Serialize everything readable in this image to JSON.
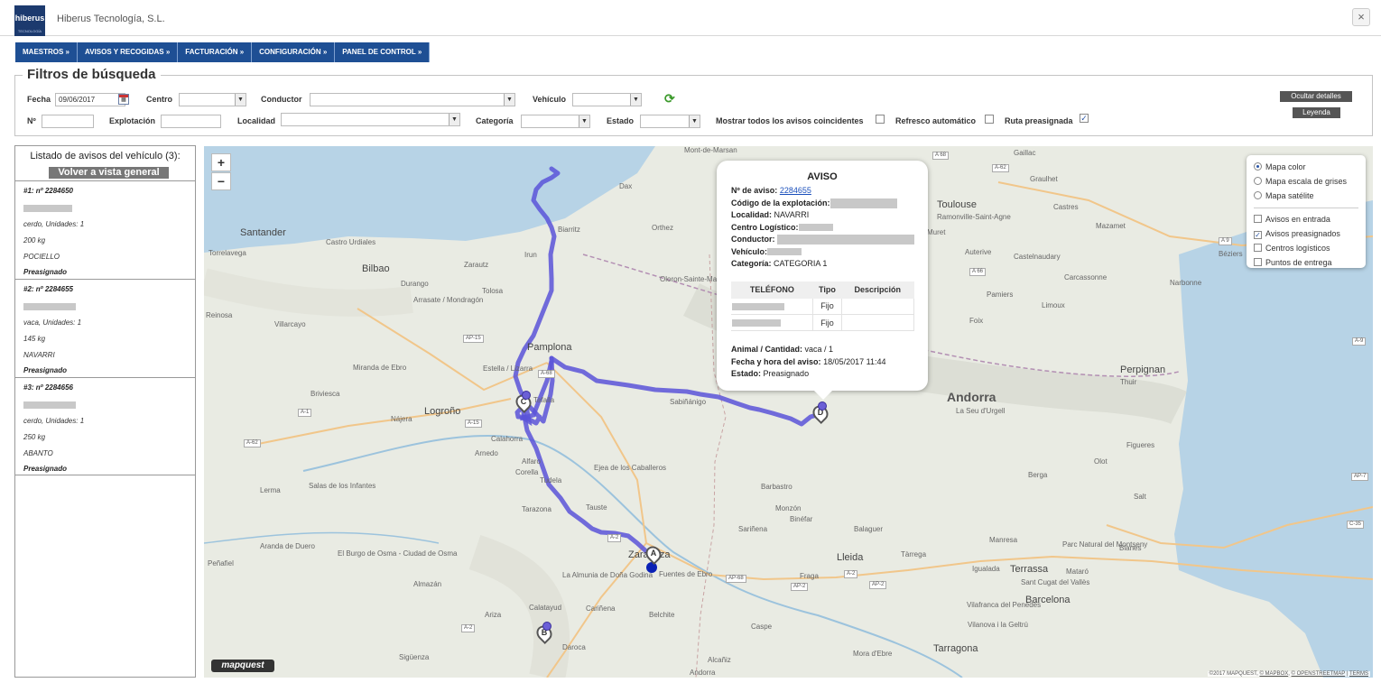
{
  "header": {
    "logo_text": "hiberus",
    "logo_subtext": "TECNOLOGÍA",
    "company": "Hiberus Tecnología, S.L.",
    "close_symbol": "×"
  },
  "menu": [
    {
      "label": "MAESTROS »"
    },
    {
      "label": "AVISOS Y RECOGIDAS »"
    },
    {
      "label": "FACTURACIÓN »"
    },
    {
      "label": "CONFIGURACIÓN »"
    },
    {
      "label": "PANEL DE CONTROL »"
    }
  ],
  "filters": {
    "legend": "Filtros de búsqueda",
    "fecha_label": "Fecha",
    "fecha_value": "09/06/2017",
    "centro_label": "Centro",
    "conductor_label": "Conductor",
    "vehiculo_label": "Vehículo",
    "numero_label": "Nº",
    "explotacion_label": "Explotación",
    "localidad_label": "Localidad",
    "categoria_label": "Categoría",
    "estado_label": "Estado",
    "mostrar_label": "Mostrar todos los avisos coincidentes",
    "refresco_label": "Refresco automático",
    "ruta_label": "Ruta preasignada",
    "ruta_checked": "✓",
    "ocultar_button": "Ocultar detalles",
    "leyenda_button": "Leyenda",
    "refresh_icon": "refresh-icon"
  },
  "list": {
    "title": "Listado de avisos del vehículo (3):",
    "back_button": "Volver a vista general",
    "items": [
      {
        "header": "#1: nº 2284650",
        "detail": "cerdo, Unidades: 1",
        "weight": "200 kg",
        "locality": "POCIELLO",
        "status": "Preasignado"
      },
      {
        "header": "#2: nº 2284655",
        "detail": "vaca, Unidades: 1",
        "weight": "145 kg",
        "locality": "NAVARRI",
        "status": "Preasignado"
      },
      {
        "header": "#3: nº 2284656",
        "detail": "cerdo, Unidades: 1",
        "weight": "250 kg",
        "locality": "ABANTO",
        "status": "Preasignado"
      }
    ]
  },
  "map": {
    "zoom_in": "+",
    "zoom_out": "−",
    "logo": "mapquest",
    "attribution_prefix": "©2017 MAPQUEST,",
    "attribution_mapbox": "© MAPBOX",
    "attribution_osm": "© OPENSTREETMAP",
    "attribution_terms": "TERMS",
    "route_color": "#5a54d8",
    "marker_a": "A",
    "marker_b": "B",
    "marker_c": "C",
    "marker_d": "D",
    "places": [
      {
        "name": "Santander",
        "cls": "big"
      },
      {
        "name": "Torrelavega",
        "cls": ""
      },
      {
        "name": "Castro Urdiales",
        "cls": ""
      },
      {
        "name": "Bilbao",
        "cls": "big"
      },
      {
        "name": "Zarautz",
        "cls": ""
      },
      {
        "name": "Irun",
        "cls": ""
      },
      {
        "name": "Biarritz",
        "cls": ""
      },
      {
        "name": "Dax",
        "cls": ""
      },
      {
        "name": "Orthez",
        "cls": ""
      },
      {
        "name": "Mont-de-Marsan",
        "cls": ""
      },
      {
        "name": "Durango",
        "cls": ""
      },
      {
        "name": "Tolosa",
        "cls": ""
      },
      {
        "name": "Arrasate / Mondragón",
        "cls": ""
      },
      {
        "name": "Oloron-Sainte-Marie",
        "cls": ""
      },
      {
        "name": "Villarcayo",
        "cls": ""
      },
      {
        "name": "Reinosa",
        "cls": ""
      },
      {
        "name": "Pamplona",
        "cls": "big"
      },
      {
        "name": "Estella / Lizarra",
        "cls": ""
      },
      {
        "name": "Miranda de Ebro",
        "cls": ""
      },
      {
        "name": "Briviesca",
        "cls": ""
      },
      {
        "name": "Logroño",
        "cls": "big"
      },
      {
        "name": "Nájera",
        "cls": ""
      },
      {
        "name": "Tafalla",
        "cls": ""
      },
      {
        "name": "Calahorra",
        "cls": ""
      },
      {
        "name": "Arnedo",
        "cls": ""
      },
      {
        "name": "Alfaro",
        "cls": ""
      },
      {
        "name": "Corella",
        "cls": ""
      },
      {
        "name": "Tudela",
        "cls": ""
      },
      {
        "name": "Ejea de los Caballeros",
        "cls": ""
      },
      {
        "name": "Lerma",
        "cls": ""
      },
      {
        "name": "Salas de los Infantes",
        "cls": ""
      },
      {
        "name": "Tarazona",
        "cls": ""
      },
      {
        "name": "Tauste",
        "cls": ""
      },
      {
        "name": "Zaragoza",
        "cls": "big"
      },
      {
        "name": "Fuentes de Ebro",
        "cls": ""
      },
      {
        "name": "La Almunia de Doña Godina",
        "cls": ""
      },
      {
        "name": "Aranda de Duero",
        "cls": ""
      },
      {
        "name": "El Burgo de Osma - Ciudad de Osma",
        "cls": ""
      },
      {
        "name": "Peñafiel",
        "cls": ""
      },
      {
        "name": "Almazán",
        "cls": ""
      },
      {
        "name": "Calatayud",
        "cls": ""
      },
      {
        "name": "Cariñena",
        "cls": ""
      },
      {
        "name": "Ariza",
        "cls": ""
      },
      {
        "name": "Belchite",
        "cls": ""
      },
      {
        "name": "Daroca",
        "cls": ""
      },
      {
        "name": "Sigüenza",
        "cls": ""
      },
      {
        "name": "Alcañiz",
        "cls": ""
      },
      {
        "name": "Andorra",
        "cls": ""
      },
      {
        "name": "Caspe",
        "cls": ""
      },
      {
        "name": "Sabiñánigo",
        "cls": ""
      },
      {
        "name": "Barbastro",
        "cls": ""
      },
      {
        "name": "Monzón",
        "cls": ""
      },
      {
        "name": "Binéfar",
        "cls": ""
      },
      {
        "name": "Sariñena",
        "cls": ""
      },
      {
        "name": "Fraga",
        "cls": ""
      },
      {
        "name": "Lleida",
        "cls": "big"
      },
      {
        "name": "Balaguer",
        "cls": ""
      },
      {
        "name": "Tàrrega",
        "cls": ""
      },
      {
        "name": "Manresa",
        "cls": ""
      },
      {
        "name": "Igualada",
        "cls": ""
      },
      {
        "name": "Terrassa",
        "cls": "big"
      },
      {
        "name": "Mataró",
        "cls": ""
      },
      {
        "name": "Sant Cugat del Vallès",
        "cls": ""
      },
      {
        "name": "Barcelona",
        "cls": "big"
      },
      {
        "name": "Vilafranca del Penedès",
        "cls": ""
      },
      {
        "name": "Vilanova i la Geltrú",
        "cls": ""
      },
      {
        "name": "Tarragona",
        "cls": "big"
      },
      {
        "name": "Mora d'Ebre",
        "cls": ""
      },
      {
        "name": "Andorra",
        "cls": "xl"
      },
      {
        "name": "La Seu d'Urgell",
        "cls": ""
      },
      {
        "name": "Foix",
        "cls": ""
      },
      {
        "name": "Pamiers",
        "cls": ""
      },
      {
        "name": "Limoux",
        "cls": ""
      },
      {
        "name": "Carcassonne",
        "cls": ""
      },
      {
        "name": "Castelnaudary",
        "cls": ""
      },
      {
        "name": "Auterive",
        "cls": ""
      },
      {
        "name": "Muret",
        "cls": ""
      },
      {
        "name": "Toulouse",
        "cls": "big"
      },
      {
        "name": "Ramonville-Saint-Agne",
        "cls": ""
      },
      {
        "name": "Castres",
        "cls": ""
      },
      {
        "name": "Mazamet",
        "cls": ""
      },
      {
        "name": "Graulhet",
        "cls": ""
      },
      {
        "name": "Gaillac",
        "cls": ""
      },
      {
        "name": "Béziers",
        "cls": ""
      },
      {
        "name": "Narbonne",
        "cls": ""
      },
      {
        "name": "Perpignan",
        "cls": "big"
      },
      {
        "name": "Thuir",
        "cls": ""
      },
      {
        "name": "Figueres",
        "cls": ""
      },
      {
        "name": "Olot",
        "cls": ""
      },
      {
        "name": "Berga",
        "cls": ""
      },
      {
        "name": "Salt",
        "cls": ""
      },
      {
        "name": "Blanes",
        "cls": ""
      },
      {
        "name": "Parc Natural del Montseny",
        "cls": ""
      }
    ],
    "roads": [
      "A-62",
      "A 68",
      "A 66",
      "A 9",
      "A-1",
      "A-62",
      "A-68",
      "AP-15",
      "A-15",
      "AP-68",
      "A-2",
      "AP-2",
      "A-2",
      "AP-2",
      "A-2",
      "A-2",
      "AP-7",
      "A-9",
      "C-35"
    ]
  },
  "popup": {
    "title": "AVISO",
    "num_label": "Nº de aviso:",
    "num_value": "2284655",
    "codigo_label": "Código de la explotación:",
    "localidad_label": "Localidad:",
    "localidad_value": "NAVARRI",
    "centro_label": "Centro Logístico:",
    "conductor_label": "Conductor:",
    "vehiculo_label": "Vehículo:",
    "categoria_label": "Categoría:",
    "categoria_value": "CATEGORIA 1",
    "table_headers": [
      "TELÉFONO",
      "Tipo",
      "Descripción"
    ],
    "phones": [
      {
        "tipo": "Fijo"
      },
      {
        "tipo": "Fijo"
      }
    ],
    "animal_label": "Animal / Cantidad:",
    "animal_value": "vaca / 1",
    "fecha_label": "Fecha y hora del aviso:",
    "fecha_value": "18/05/2017 11:44",
    "estado_label": "Estado:",
    "estado_value": "Preasignado"
  },
  "layers": {
    "base": [
      {
        "label": "Mapa color",
        "selected": true
      },
      {
        "label": "Mapa escala de grises",
        "selected": false
      },
      {
        "label": "Mapa satélite",
        "selected": false
      }
    ],
    "overlays": [
      {
        "label": "Avisos en entrada",
        "checked": false
      },
      {
        "label": "Avisos preasignados",
        "checked": true
      },
      {
        "label": "Centros logísticos",
        "checked": false
      },
      {
        "label": "Puntos de entrega",
        "checked": false
      }
    ],
    "check_mark": "✓"
  }
}
